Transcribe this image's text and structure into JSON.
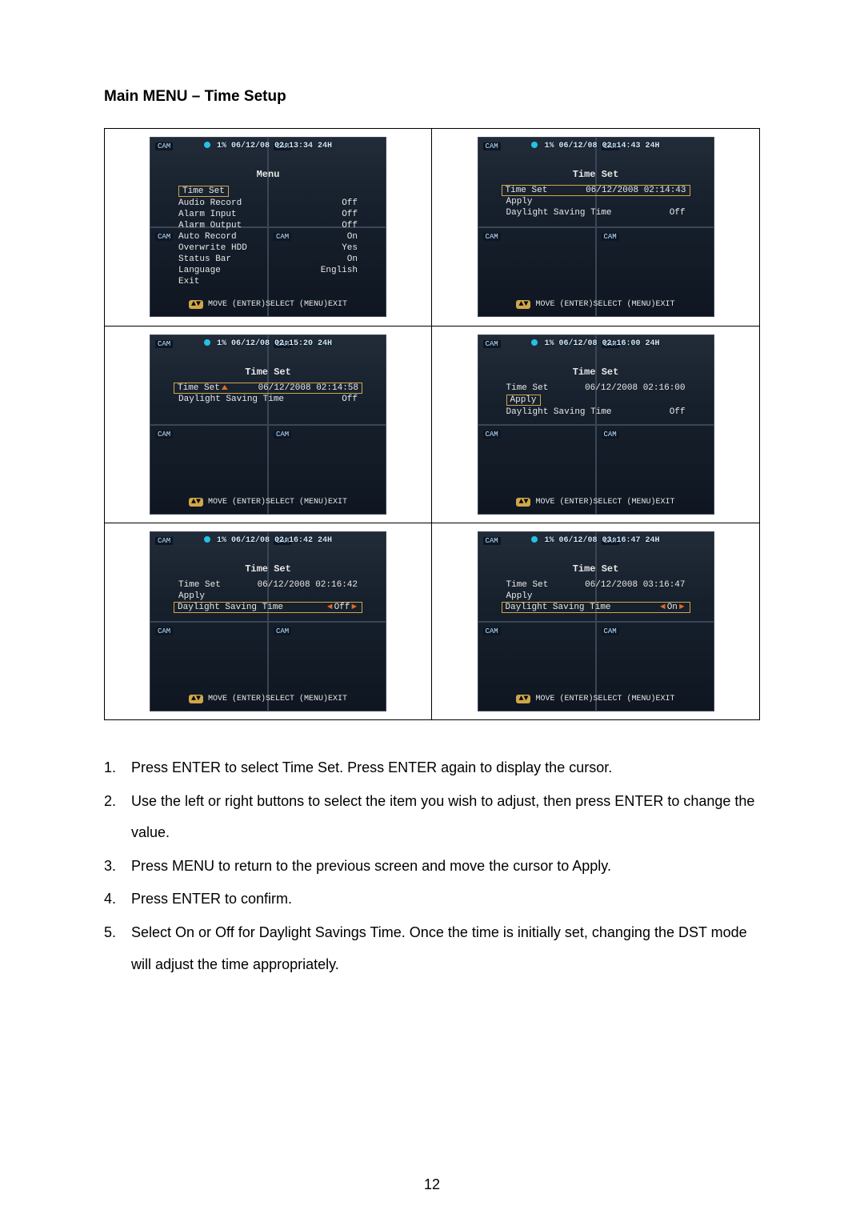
{
  "heading": "Main MENU – Time Setup",
  "page_number": "12",
  "helpbar": {
    "arrows": "▲▼",
    "text": "MOVE (ENTER)SELECT (MENU)EXIT"
  },
  "camlabel": "CAM",
  "screens": [
    {
      "timestamp": "1% 06/12/08 02:13:34 24H",
      "title": "Menu",
      "highlight": "Time Set",
      "rows": [
        {
          "label": "Audio Record",
          "value": "Off"
        },
        {
          "label": "Alarm Input",
          "value": "Off"
        },
        {
          "label": "Alarm Output",
          "value": "Off"
        },
        {
          "label": "Auto Record",
          "value": "On"
        },
        {
          "label": "Overwrite HDD",
          "value": "Yes"
        },
        {
          "label": "Status Bar",
          "value": "On"
        },
        {
          "label": "Language",
          "value": "English"
        },
        {
          "label": "Exit",
          "value": ""
        }
      ]
    },
    {
      "timestamp": "1% 06/12/08 02:14:43 24H",
      "title": "Time Set",
      "boxed_row": {
        "label": "Time Set",
        "value": "06/12/2008 02:14:43"
      },
      "rows": [
        {
          "label": "Apply",
          "value": ""
        },
        {
          "label": "Daylight Saving Time",
          "value": "Off"
        }
      ]
    },
    {
      "timestamp": "1% 06/12/08 02:15:20 24H",
      "title": "Time Set",
      "boxed_row": {
        "label": "Time Set",
        "value": "06/12/2008 02:14:58",
        "cursor": true
      },
      "rows": [
        {
          "label": "Daylight Saving Time",
          "value": "Off"
        }
      ]
    },
    {
      "timestamp": "1% 06/12/08 02:16:00 24H",
      "title": "Time Set",
      "plain_row": {
        "label": "Time Set",
        "value": "06/12/2008 02:16:00"
      },
      "boxed_label": "Apply",
      "rows": [
        {
          "label": "Daylight Saving Time",
          "value": "Off"
        }
      ]
    },
    {
      "timestamp": "1% 06/12/08 02:16:42 24H",
      "title": "Time Set",
      "plain_row": {
        "label": "Time Set",
        "value": "06/12/2008 02:16:42"
      },
      "rows": [
        {
          "label": "Apply",
          "value": ""
        }
      ],
      "boxed_dst": {
        "label": "Daylight Saving Time",
        "value": "Off",
        "arrows": true
      }
    },
    {
      "timestamp": "1% 06/12/08 03:16:47 24H",
      "title": "Time Set",
      "plain_row": {
        "label": "Time Set",
        "value": "06/12/2008 03:16:47"
      },
      "rows": [
        {
          "label": "Apply",
          "value": ""
        }
      ],
      "boxed_dst": {
        "label": "Daylight Saving Time",
        "value": "On",
        "arrows": true
      }
    }
  ],
  "instructions": [
    "Press ENTER to select Time Set.   Press ENTER again to display the cursor.",
    "Use the left or right buttons to select the item you wish to adjust, then press ENTER to change the value.",
    "Press MENU to return to the previous screen and move the cursor to Apply.",
    "Press ENTER to confirm.",
    "Select On or Off for Daylight Savings Time.   Once the time is initially set, changing the DST mode will adjust the time appropriately."
  ]
}
